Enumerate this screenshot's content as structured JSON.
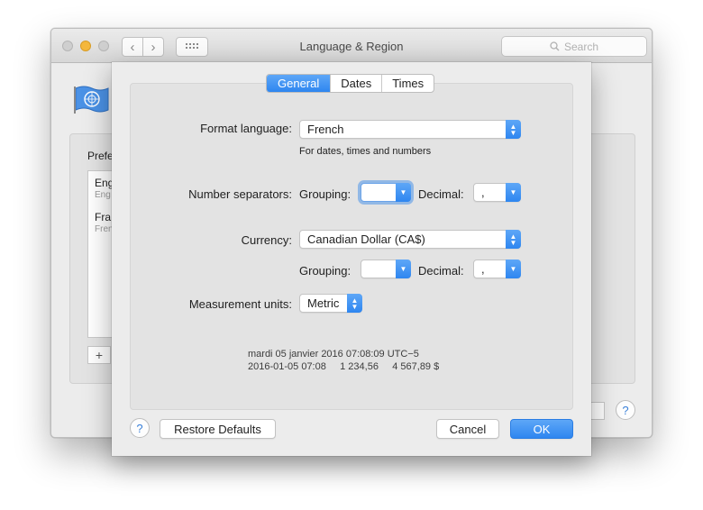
{
  "window": {
    "title": "Language & Region",
    "search_placeholder": "Search"
  },
  "background": {
    "pref_label": "Prefe",
    "list_items": [
      {
        "name": "Eng",
        "sub": "Eng"
      },
      {
        "name": "Fra",
        "sub": "Fren"
      }
    ],
    "add_label": "+",
    "help_label": "?"
  },
  "tabs": [
    {
      "label": "General",
      "active": true
    },
    {
      "label": "Dates",
      "active": false
    },
    {
      "label": "Times",
      "active": false
    }
  ],
  "form": {
    "format_language_label": "Format language:",
    "format_language_value": "French",
    "format_language_note": "For dates, times and numbers",
    "number_separators_label": "Number separators:",
    "grouping_label": "Grouping:",
    "grouping_value": "",
    "decimal_label": "Decimal:",
    "decimal_value": ",",
    "currency_label": "Currency:",
    "currency_value": "Canadian Dollar (CA$)",
    "currency_grouping_label": "Grouping:",
    "currency_grouping_value": "",
    "currency_decimal_label": "Decimal:",
    "currency_decimal_value": ",",
    "measurement_label": "Measurement units:",
    "measurement_value": "Metric"
  },
  "samples": {
    "line1": "mardi 05 janvier 2016 07:08:09 UTC−5",
    "line2": "2016-01-05 07:08     1 234,56     4 567,89 $"
  },
  "buttons": {
    "help": "?",
    "restore": "Restore Defaults",
    "cancel": "Cancel",
    "ok": "OK"
  },
  "colors": {
    "accent": "#2e86f0",
    "minimize": "#f4b73c"
  }
}
